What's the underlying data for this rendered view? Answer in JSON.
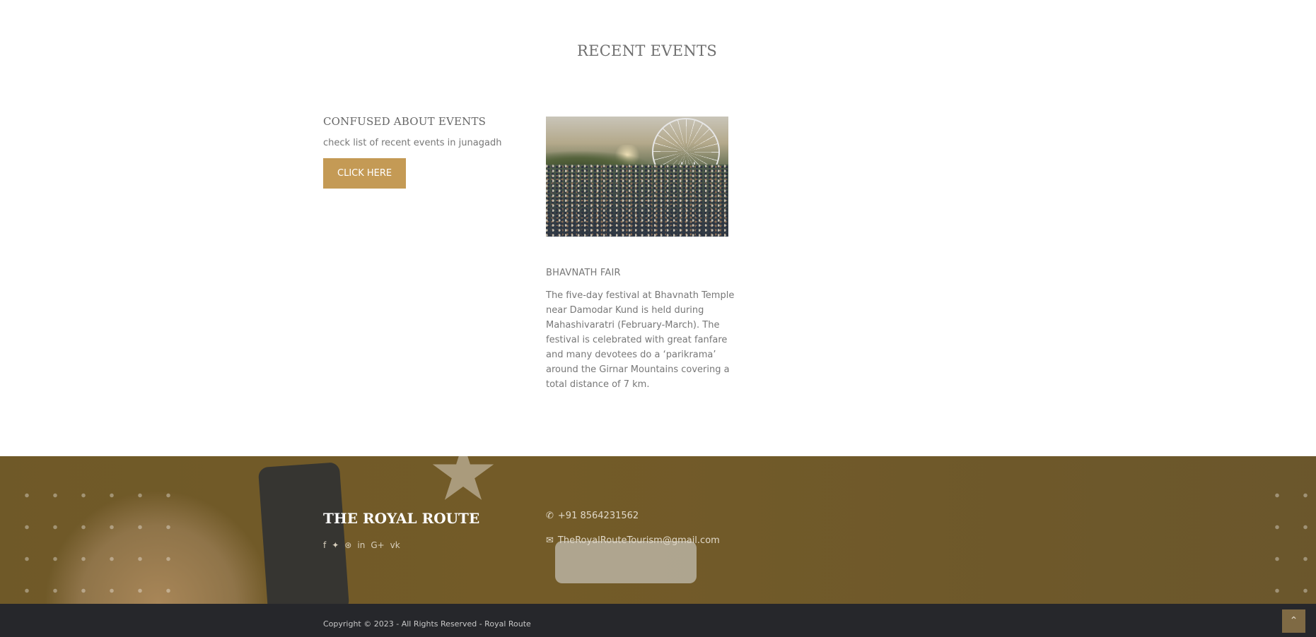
{
  "section": {
    "title": "RECENT EVENTS"
  },
  "promo": {
    "heading": "CONFUSED ABOUT EVENTS",
    "text": "check list of recent events in junagadh",
    "button_label": "CLICK HERE"
  },
  "event": {
    "title": "BHAVNATH FAIR",
    "description": "The five-day festival at Bhavnath Temple near Damodar Kund is held during Mahashivaratri (February-March). The festival is celebrated with great fanfare and many devotees do a ‘parikrama’ around the Girnar Mountains covering a total distance of 7 km."
  },
  "footer": {
    "brand": "THE ROYAL ROUTE",
    "socials": [
      {
        "icon": "facebook-icon",
        "glyph": "f"
      },
      {
        "icon": "twitter-icon",
        "glyph": "🐦"
      },
      {
        "icon": "dribbble-icon",
        "glyph": "⊛"
      },
      {
        "icon": "linkedin-icon",
        "glyph": "in"
      },
      {
        "icon": "google-plus-icon",
        "glyph": "G+"
      },
      {
        "icon": "vk-icon",
        "glyph": "vk"
      }
    ],
    "phone": "+91 8564231562",
    "email": "TheRoyalRouteTourism@gmail.com",
    "phone_icon": "phone-icon",
    "email_icon": "envelope-icon"
  },
  "copyright": "Copyright © 2023 - All Rights Reserved - Royal Route",
  "back_to_top": {
    "icon": "chevron-up-icon",
    "glyph": "⌃"
  },
  "colors": {
    "accent": "#c49a55",
    "footer_overlay": "#7a6228",
    "copyright_bg": "#26272b"
  }
}
